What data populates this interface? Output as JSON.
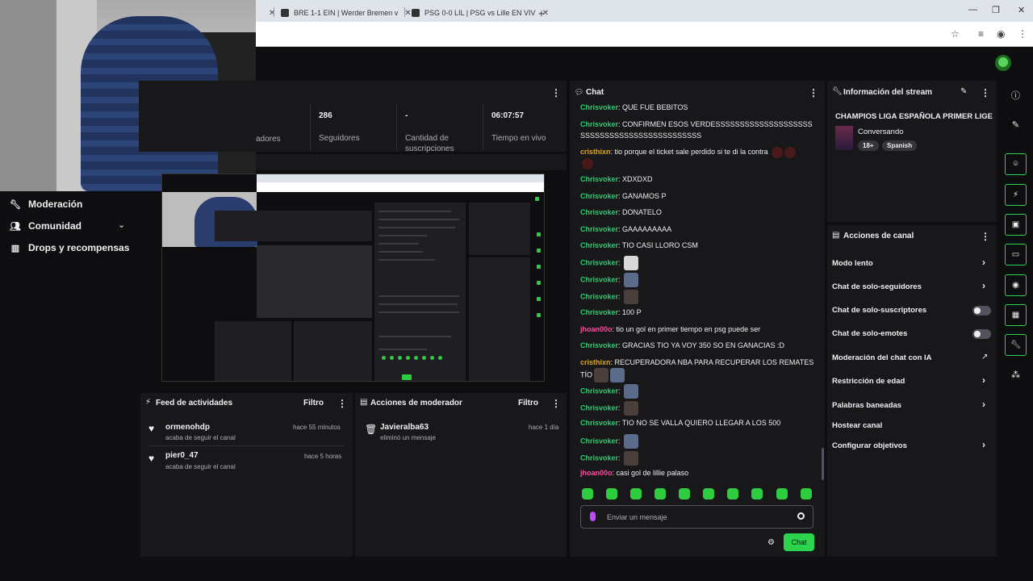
{
  "browser": {
    "tabs": [
      {
        "title": "BRE 1-1 EIN | Werder Bremen v"
      },
      {
        "title": "PSG 0-0 LIL | PSG vs Lille EN VIV"
      }
    ],
    "close_glyph": "✕",
    "new_tab_glyph": "+",
    "window_controls": {
      "minimize": "—",
      "restore": "❐",
      "close": "✕"
    }
  },
  "nav": {
    "items": [
      {
        "label": "Moderación",
        "icon": "wrench-icon"
      },
      {
        "label": "Comunidad",
        "icon": "community-icon"
      },
      {
        "label": "Drops y recompensas",
        "icon": "drops-icon"
      }
    ]
  },
  "stats": {
    "items": [
      {
        "value": "",
        "label": "adores"
      },
      {
        "value": "286",
        "label": "Seguidores"
      },
      {
        "value": "-",
        "label": "Cantidad de suscripciones"
      },
      {
        "value": "06:07:57",
        "label": "Tiempo en vivo"
      }
    ]
  },
  "activity_feed": {
    "title": "Feed de actividades",
    "filter_label": "Filtro",
    "items": [
      {
        "name": "ormenohdp",
        "sub": "acaba de seguir el canal",
        "time": "hace 55 minutos"
      },
      {
        "name": "pier0_47",
        "sub": "acaba de seguir el canal",
        "time": "hace 5 horas"
      }
    ]
  },
  "mod_actions": {
    "title": "Acciones de moderador",
    "filter_label": "Filtro",
    "items": [
      {
        "name": "Javieralba63",
        "sub": "eliminó un mensaje",
        "time": "hace 1 día"
      }
    ]
  },
  "chat": {
    "title": "Chat",
    "messages": [
      {
        "user": "Chrisvoker",
        "color": "green",
        "text": "QUE FUE BEBITOS"
      },
      {
        "user": "Chrisvoker",
        "color": "green",
        "text": "CONFIRMEN ESOS VERDESSSSSSSSSSSSSSSSSSSSSSSSSSSSSSSSSSSSSSSSSSSSS"
      },
      {
        "user": "cristhixn",
        "color": "gold",
        "text": "tio porque el ticket sale perdido si te di la contra"
      },
      {
        "user": "Chrisvoker",
        "color": "green",
        "text": "XDXDXD"
      },
      {
        "user": "Chrisvoker",
        "color": "green",
        "text": "GANAMOS P"
      },
      {
        "user": "Chrisvoker",
        "color": "green",
        "text": "DONATELO"
      },
      {
        "user": "Chrisvoker",
        "color": "green",
        "text": "GAAAAAAAAA"
      },
      {
        "user": "Chrisvoker",
        "color": "green",
        "text": "TIO CASI LLORO CSM"
      },
      {
        "user": "Chrisvoker",
        "color": "green",
        "text": ""
      },
      {
        "user": "Chrisvoker",
        "color": "green",
        "text": ""
      },
      {
        "user": "Chrisvoker",
        "color": "green",
        "text": ""
      },
      {
        "user": "Chrisvoker",
        "color": "green",
        "text": "100 P"
      },
      {
        "user": "jhoan00o",
        "color": "pink",
        "text": "tio un gol en primer tiempo en psg puede ser"
      },
      {
        "user": "Chrisvoker",
        "color": "green",
        "text": "GRACIAS TIO YA VOY 350 SO EN GANACIAS :D"
      },
      {
        "user": "cristhixn",
        "color": "gold",
        "text": "RECUPERADORA NBA PARA RECUPERAR LOS REMATES TÍO"
      },
      {
        "user": "Chrisvoker",
        "color": "green",
        "text": ""
      },
      {
        "user": "Chrisvoker",
        "color": "green",
        "text": ""
      },
      {
        "user": "Chrisvoker",
        "color": "green",
        "text": "TIO NO SE VALLA QUIERO LLEGAR A LOS 500"
      },
      {
        "user": "Chrisvoker",
        "color": "green",
        "text": ""
      },
      {
        "user": "Chrisvoker",
        "color": "green",
        "text": ""
      },
      {
        "user": "jhoan00o",
        "color": "pink",
        "text": "casi gol de lillie palaso"
      }
    ],
    "input_placeholder": "Enviar un mensaje",
    "send_label": "Chat"
  },
  "stream_info": {
    "title": "Información del stream",
    "stream_title": "CHAMPIOS LIGA ESPAÑOLA PRIMER LIGE",
    "category": "Conversando",
    "tags": [
      "18+",
      "Spanish"
    ]
  },
  "channel_actions": {
    "title": "Acciones de canal",
    "items": [
      {
        "label": "Modo lento",
        "control": "chevron"
      },
      {
        "label": "Chat de solo-seguidores",
        "control": "chevron"
      },
      {
        "label": "Chat de solo-suscriptores",
        "control": "toggle"
      },
      {
        "label": "Chat de solo-emotes",
        "control": "toggle"
      },
      {
        "label": "Moderación del chat con IA",
        "control": "external"
      },
      {
        "label": "Restricción de edad",
        "control": "chevron"
      },
      {
        "label": "Palabras baneadas",
        "control": "chevron"
      },
      {
        "label": "Hostear canal",
        "control": "none"
      },
      {
        "label": "Configurar objetivos",
        "control": "chevron"
      }
    ]
  },
  "colors": {
    "accent": "#2bd44a",
    "user_green": "#2ecc71",
    "user_pink": "#ff4aa0",
    "user_gold": "#daa520",
    "panel": "#18181b",
    "background": "#0e0e10"
  }
}
